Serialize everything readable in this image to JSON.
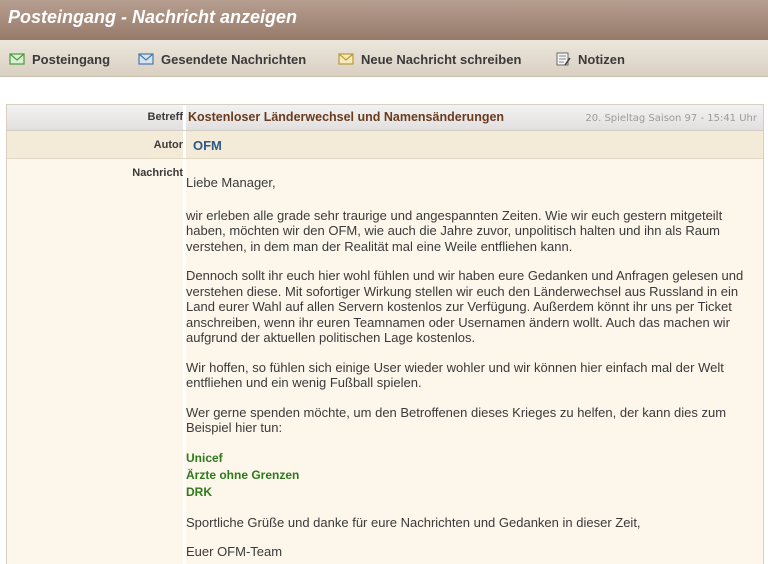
{
  "page": {
    "title": "Posteingang - Nachricht anzeigen"
  },
  "nav": {
    "items": [
      {
        "label": "Posteingang",
        "icon": "envelope-green-icon"
      },
      {
        "label": "Gesendete Nachrichten",
        "icon": "envelope-blue-icon"
      },
      {
        "label": "Neue Nachricht schreiben",
        "icon": "envelope-yellow-icon"
      },
      {
        "label": "Notizen",
        "icon": "notepad-icon"
      }
    ]
  },
  "message": {
    "labels": {
      "subject": "Betreff",
      "author": "Autor",
      "body": "Nachricht"
    },
    "subject": "Kostenloser Länderwechsel und Namensänderungen",
    "meta": "20. Spieltag Saison 97 - 15:41 Uhr",
    "author": "OFM",
    "greeting": "Liebe Manager,",
    "paragraphs": [
      "wir erleben alle grade sehr traurige und angespannten Zeiten. Wie wir euch gestern mitgeteilt haben, möchten wir den OFM, wie auch die Jahre zuvor, unpolitisch halten und ihn als Raum verstehen, in dem man der Realität mal eine Weile entfliehen kann.",
      "Dennoch sollt ihr euch hier wohl fühlen und wir haben eure Gedanken und Anfragen gelesen und verstehen diese. Mit sofortiger Wirkung stellen wir euch den Länderwechsel aus Russland in ein Land eurer Wahl auf allen Servern kostenlos zur Verfügung. Außerdem könnt ihr uns per Ticket anschreiben, wenn ihr euren Teamnamen oder Usernamen ändern wollt. Auch das machen wir aufgrund der aktuellen politischen Lage kostenlos.",
      "Wir hoffen, so fühlen sich einige User wieder wohler und wir können hier einfach mal der Welt entfliehen und ein wenig Fußball spielen.",
      "Wer gerne spenden möchte, um den Betroffenen dieses Krieges zu helfen, der kann dies zum Beispiel hier tun:"
    ],
    "donation_links": [
      "Unicef",
      "Ärzte ohne Grenzen",
      "DRK"
    ],
    "closing": "Sportliche Grüße und danke für eure Nachrichten und Gedanken in dieser Zeit,",
    "signature": "Euer OFM-Team"
  },
  "colors": {
    "title_bar": "#a38a7b",
    "subject_text": "#6b3b1d",
    "author_link": "#2e5a88",
    "donation_link": "#2f7a1d",
    "message_background": "#fdf6ea"
  }
}
